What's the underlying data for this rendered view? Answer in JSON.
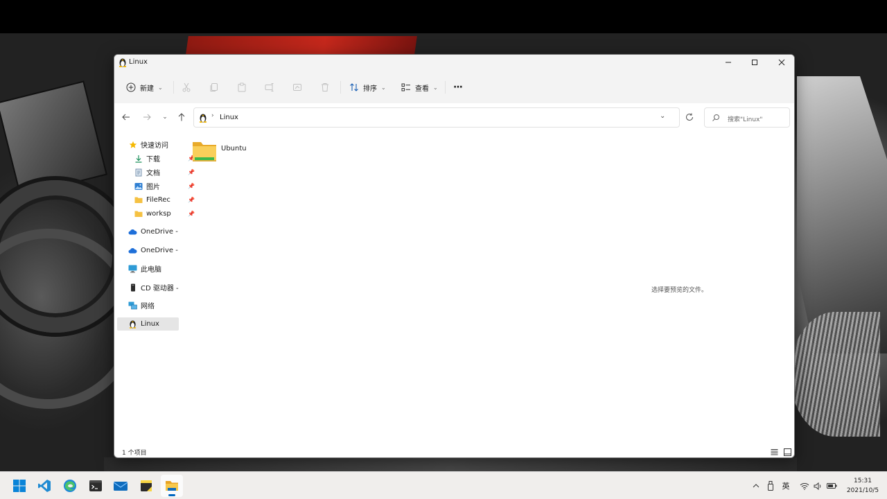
{
  "window": {
    "title": "Linux",
    "controls": {
      "minimize": "minimize",
      "maximize": "maximize",
      "close": "close"
    }
  },
  "toolbar": {
    "new_label": "新建",
    "sort_label": "排序",
    "view_label": "查看",
    "more_label": "···",
    "icons": [
      "plus-circle-icon",
      "cut-icon",
      "copy-icon",
      "paste-icon",
      "rename-icon",
      "share-icon",
      "delete-icon",
      "sort-icon",
      "view-icon",
      "more-icon"
    ]
  },
  "nav": {
    "path_root_label": "Linux",
    "search_placeholder": "搜索\"Linux\""
  },
  "sidebar": {
    "items": [
      {
        "label": "快速访问",
        "icon": "star-icon",
        "pinned": false
      },
      {
        "label": "下载",
        "icon": "download-icon",
        "pinned": true
      },
      {
        "label": "文档",
        "icon": "document-icon",
        "pinned": true
      },
      {
        "label": "图片",
        "icon": "pictures-icon",
        "pinned": true
      },
      {
        "label": "FileRec",
        "icon": "folder-icon",
        "pinned": true
      },
      {
        "label": "worksp",
        "icon": "folder-icon",
        "pinned": true
      },
      {
        "label": "OneDrive -",
        "icon": "cloud-icon",
        "pinned": false
      },
      {
        "label": "OneDrive -",
        "icon": "cloud-icon",
        "pinned": false
      },
      {
        "label": "此电脑",
        "icon": "computer-icon",
        "pinned": false
      },
      {
        "label": "CD 驱动器 -",
        "icon": "drive-icon",
        "pinned": false
      },
      {
        "label": "网络",
        "icon": "network-icon",
        "pinned": false
      },
      {
        "label": "Linux",
        "icon": "linux-icon",
        "pinned": false,
        "selected": true
      }
    ]
  },
  "content": {
    "files": [
      {
        "name": "Ubuntu",
        "type": "folder"
      }
    ],
    "preview_message": "选择要预览的文件。"
  },
  "status": {
    "item_count": "1 个项目"
  },
  "taskbar": {
    "apps": [
      "windows-start-icon",
      "vscode-icon",
      "edge-icon",
      "terminal-icon",
      "mail-icon",
      "sticky-notes-icon",
      "file-explorer-icon"
    ],
    "ime_label": "英",
    "time": "15:31",
    "date": "2021/10/5"
  },
  "colors": {
    "accent": "#0067c0",
    "folder_yellow": "#f5c142",
    "window_bg": "#ffffff",
    "toolbar_bg": "#f3f3f3"
  }
}
